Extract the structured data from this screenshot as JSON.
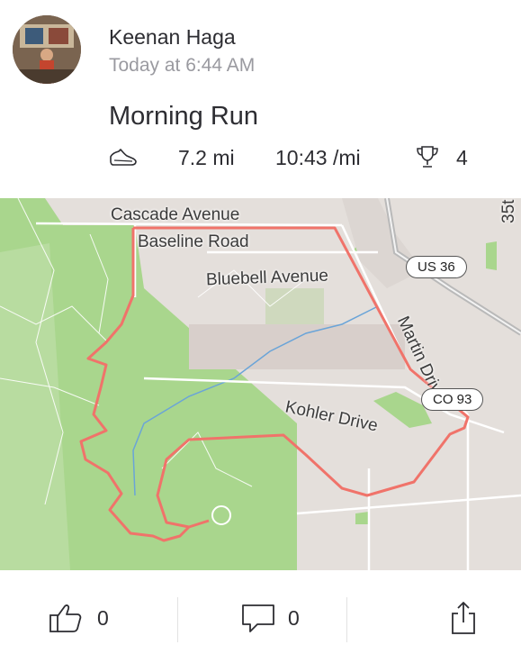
{
  "athlete": {
    "name": "Keenan Haga",
    "timestamp": "Today at 6:44 AM",
    "avatar_icon": "avatar-photo"
  },
  "activity": {
    "title": "Morning Run",
    "type_icon": "shoe-icon",
    "distance": "7.2 mi",
    "pace": "10:43 /mi",
    "achievements_icon": "trophy-icon",
    "achievements": "4"
  },
  "map": {
    "labels": {
      "cascade": "Cascade Avenue",
      "baseline": "Baseline Road",
      "bluebell": "Bluebell Avenue",
      "martin": "Martin Drive",
      "kohler": "Kohler Drive",
      "street35": "35t"
    },
    "shields": {
      "us36": "US 36",
      "co93": "CO 93"
    },
    "colors": {
      "route": "#f0736a",
      "park": "#a9d68d",
      "land": "#e4dfdb",
      "water": "#6aa4d8"
    }
  },
  "actions": {
    "kudos_count": "0",
    "comment_count": "0"
  }
}
